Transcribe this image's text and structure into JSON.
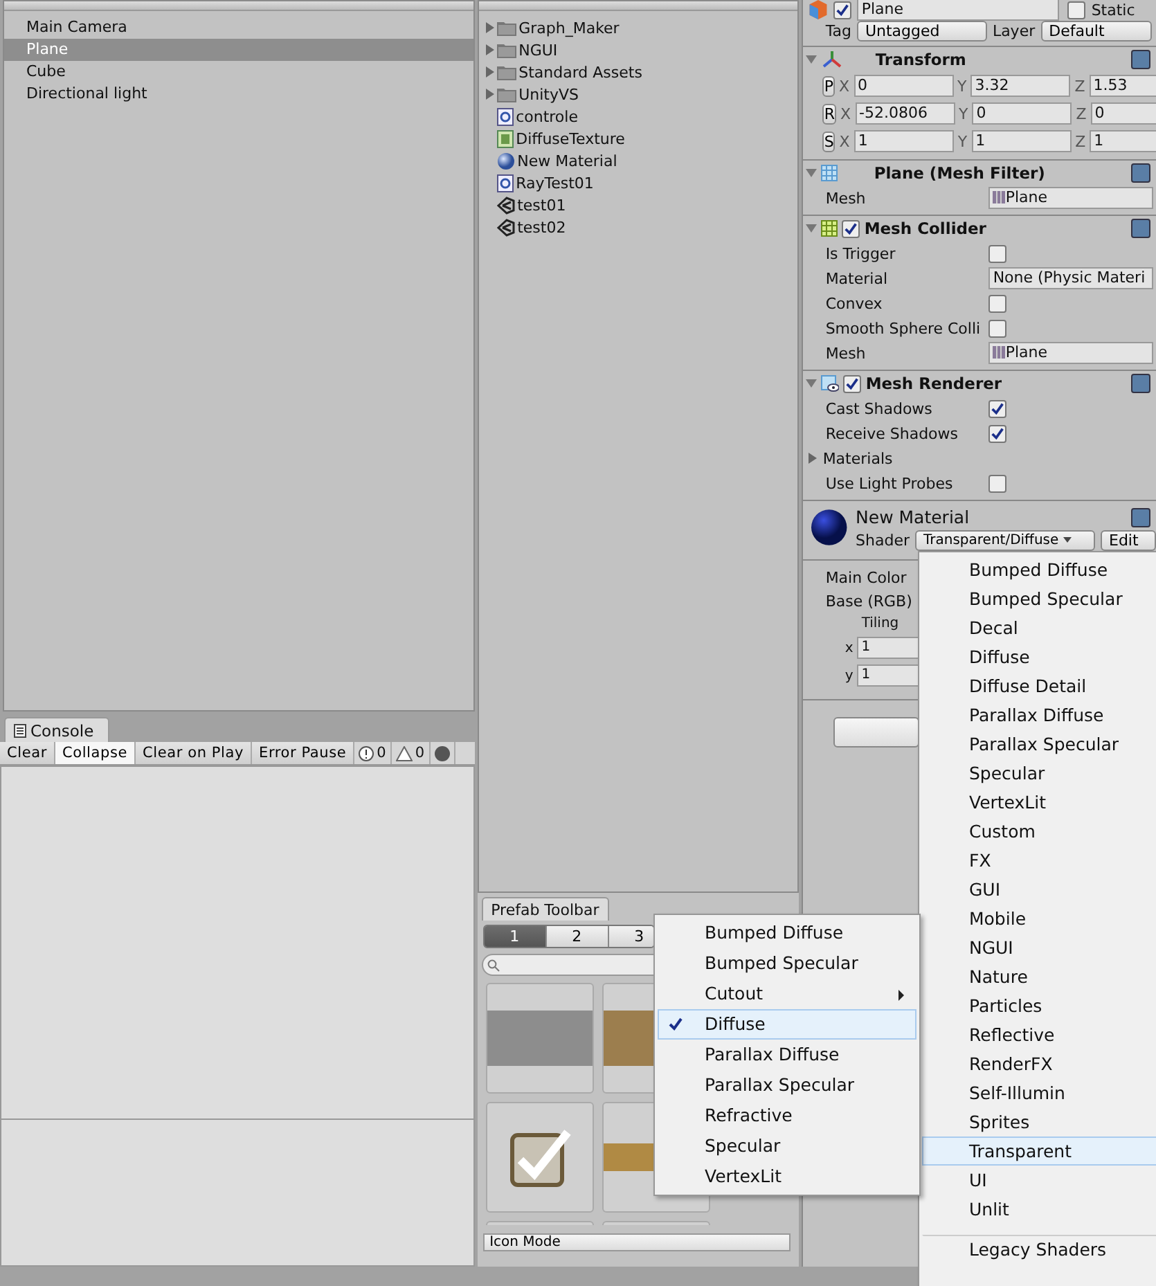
{
  "hierarchy": {
    "items": [
      {
        "label": "Main Camera",
        "selected": false
      },
      {
        "label": "Plane",
        "selected": true
      },
      {
        "label": "Cube",
        "selected": false
      },
      {
        "label": "Directional light",
        "selected": false
      }
    ]
  },
  "console": {
    "tab": "Console",
    "buttons": [
      {
        "label": "Clear",
        "on": false
      },
      {
        "label": "Collapse",
        "on": true
      },
      {
        "label": "Clear on Play",
        "on": false
      },
      {
        "label": "Error Pause",
        "on": false
      }
    ],
    "info_count": "0",
    "warning_count": "0"
  },
  "project": {
    "items": [
      {
        "label": "Graph_Maker",
        "kind": "folder"
      },
      {
        "label": "NGUI",
        "kind": "folder"
      },
      {
        "label": "Standard Assets",
        "kind": "folder"
      },
      {
        "label": "UnityVS",
        "kind": "folder"
      },
      {
        "label": "controle",
        "kind": "script"
      },
      {
        "label": "DiffuseTexture",
        "kind": "shader"
      },
      {
        "label": "New Material",
        "kind": "material"
      },
      {
        "label": "RayTest01",
        "kind": "script"
      },
      {
        "label": "test01",
        "kind": "scene"
      },
      {
        "label": "test02",
        "kind": "scene"
      }
    ]
  },
  "prefab_toolbar": {
    "tab": "Prefab Toolbar",
    "pages": [
      {
        "label": "1",
        "selected": true
      },
      {
        "label": "2",
        "selected": false
      },
      {
        "label": "3",
        "selected": false
      }
    ],
    "mode": "Icon Mode"
  },
  "inspector": {
    "object": {
      "name": "Plane",
      "active": true,
      "static_label": "Static",
      "static": false,
      "tag_label": "Tag",
      "tag": "Untagged",
      "layer_label": "Layer",
      "layer": "Default"
    },
    "transform": {
      "title": "Transform",
      "rows": [
        {
          "button": "P",
          "fields": [
            {
              "axis": "X",
              "value": "0"
            },
            {
              "axis": "Y",
              "value": "3.32"
            },
            {
              "axis": "Z",
              "value": "1.53"
            }
          ]
        },
        {
          "button": "R",
          "fields": [
            {
              "axis": "X",
              "value": "-52.0806"
            },
            {
              "axis": "Y",
              "value": "0"
            },
            {
              "axis": "Z",
              "value": "0"
            }
          ]
        },
        {
          "button": "S",
          "fields": [
            {
              "axis": "X",
              "value": "1"
            },
            {
              "axis": "Y",
              "value": "1"
            },
            {
              "axis": "Z",
              "value": "1"
            }
          ]
        }
      ]
    },
    "components": [
      {
        "title": "Plane (Mesh Filter)",
        "rows": [
          {
            "kind": "object",
            "label": "Mesh",
            "value": "Plane"
          }
        ]
      },
      {
        "title": "Mesh Collider",
        "enabled": true,
        "rows": [
          {
            "kind": "checkbox",
            "label": "Is Trigger",
            "checked": false
          },
          {
            "kind": "field",
            "label": "Material",
            "value": "None (Physic Materi"
          },
          {
            "kind": "checkbox",
            "label": "Convex",
            "checked": false
          },
          {
            "kind": "checkbox",
            "label": "Smooth Sphere Colli",
            "checked": false
          },
          {
            "kind": "object",
            "label": "Mesh",
            "value": "Plane"
          }
        ]
      },
      {
        "title": "Mesh Renderer",
        "enabled": true,
        "rows": [
          {
            "kind": "checkbox",
            "label": "Cast Shadows",
            "checked": true
          },
          {
            "kind": "checkbox",
            "label": "Receive Shadows",
            "checked": true
          },
          {
            "kind": "foldout",
            "label": "Materials"
          },
          {
            "kind": "checkbox",
            "label": "Use Light Probes",
            "checked": false
          }
        ]
      }
    ],
    "material": {
      "name": "New Material",
      "shader_label": "Shader",
      "shader": "Transparent/Diffuse",
      "edit": "Edit",
      "props": [
        "Main Color",
        "Base (RGB)"
      ],
      "tiling": "Tiling",
      "tiling_rows": [
        {
          "axis": "x",
          "value": "1"
        },
        {
          "axis": "y",
          "value": "1"
        }
      ]
    }
  },
  "shader_menu": {
    "items": [
      {
        "label": "Bumped Diffuse",
        "highlighted": false
      },
      {
        "label": "Bumped Specular",
        "highlighted": false
      },
      {
        "label": "Decal",
        "highlighted": false
      },
      {
        "label": "Diffuse",
        "highlighted": false
      },
      {
        "label": "Diffuse Detail",
        "highlighted": false
      },
      {
        "label": "Parallax Diffuse",
        "highlighted": false
      },
      {
        "label": "Parallax Specular",
        "highlighted": false
      },
      {
        "label": "Specular",
        "highlighted": false
      },
      {
        "label": "VertexLit",
        "highlighted": false
      },
      {
        "label": "Custom",
        "highlighted": false
      },
      {
        "label": "FX",
        "highlighted": false
      },
      {
        "label": "GUI",
        "highlighted": false
      },
      {
        "label": "Mobile",
        "highlighted": false
      },
      {
        "label": "NGUI",
        "highlighted": false
      },
      {
        "label": "Nature",
        "highlighted": false
      },
      {
        "label": "Particles",
        "highlighted": false
      },
      {
        "label": "Reflective",
        "highlighted": false
      },
      {
        "label": "RenderFX",
        "highlighted": false
      },
      {
        "label": "Self-Illumin",
        "highlighted": false
      },
      {
        "label": "Sprites",
        "highlighted": false
      },
      {
        "label": "Transparent",
        "highlighted": true
      },
      {
        "label": "UI",
        "highlighted": false
      },
      {
        "label": "Unlit",
        "highlighted": false
      },
      {
        "label": "Legacy Shaders",
        "highlighted": false,
        "divider_above": true
      }
    ]
  },
  "transparent_submenu": {
    "items": [
      {
        "label": "Bumped Diffuse",
        "checked": false,
        "submenu": false
      },
      {
        "label": "Bumped Specular",
        "checked": false,
        "submenu": false
      },
      {
        "label": "Cutout",
        "checked": false,
        "submenu": true
      },
      {
        "label": "Diffuse",
        "checked": true,
        "submenu": false
      },
      {
        "label": "Parallax Diffuse",
        "checked": false,
        "submenu": false
      },
      {
        "label": "Parallax Specular",
        "checked": false,
        "submenu": false
      },
      {
        "label": "Refractive",
        "checked": false,
        "submenu": false
      },
      {
        "label": "Specular",
        "checked": false,
        "submenu": false
      },
      {
        "label": "VertexLit",
        "checked": false,
        "submenu": false
      }
    ]
  }
}
